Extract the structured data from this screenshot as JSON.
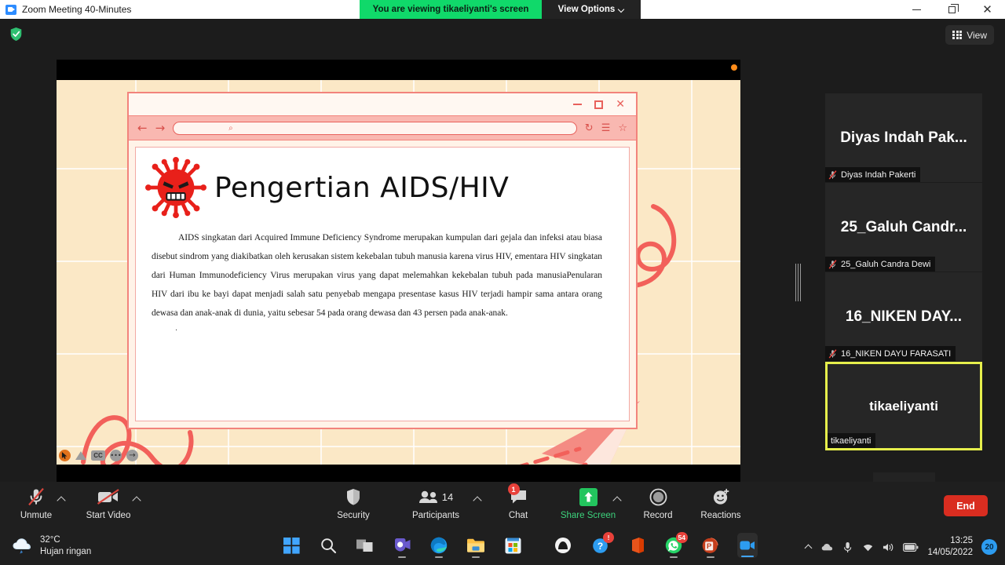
{
  "titlebar": {
    "app_title": "Zoom Meeting 40-Minutes",
    "share_banner": "You are viewing tikaeliyanti's screen",
    "view_options": "View Options",
    "minimize": "–",
    "restore": "❐",
    "close": "✕"
  },
  "stage": {
    "view_button": "View"
  },
  "slide": {
    "title": "Pengertian AIDS/HIV",
    "body": "AIDS singkatan dari Acquired Immune Deficiency Syndrome  merupakan kumpulan dari gejala dan infeksi atau biasa disebut sindrom  yang diakibatkan oleh kerusakan sistem kekebalan tubuh manusia karena  virus HIV, ementara HIV singkatan dari Human Immunodeficiency Virus merupakan virus yang dapat melemahkan kekebalan tubuh pada manusiaPenularan HIV dari ibu ke bayi dapat menjadi salah satu penyebab mengapa presentase kasus HIV terjadi hampir sama antara orang dewasa dan anak-anak di dunia, yaitu sebesar 54 pada orang dewasa dan 43 persen pada anak-anak.",
    "trailing_dot": ".",
    "browser": {
      "back": "←",
      "forward": "→",
      "search_glyph": "⌕",
      "reload": "↻",
      "menu": "☰",
      "bookmark": "☆",
      "minimize": "–",
      "maximize": "□",
      "close": "✕"
    },
    "annotation_bar": {
      "cc_label": "CC",
      "more": "•••",
      "arrow": "→"
    }
  },
  "participants": [
    {
      "initials": "Diyas Indah Pak...",
      "name": "Diyas Indah Pakerti",
      "muted": true,
      "active": false
    },
    {
      "initials": "25_Galuh Candr...",
      "name": "25_Galuh Candra Dewi",
      "muted": true,
      "active": false
    },
    {
      "initials": "16_NIKEN DAY...",
      "name": "16_NIKEN DAYU FARASATI",
      "muted": true,
      "active": false
    },
    {
      "initials": "tikaeliyanti",
      "name": "tikaeliyanti",
      "muted": false,
      "active": true
    }
  ],
  "toolbar": {
    "unmute": "Unmute",
    "start_video": "Start Video",
    "security": "Security",
    "participants": "Participants",
    "participants_count": "14",
    "chat": "Chat",
    "chat_badge": "1",
    "share_screen": "Share Screen",
    "record": "Record",
    "reactions": "Reactions",
    "end": "End"
  },
  "taskbar": {
    "weather_temp": "32°C",
    "weather_desc": "Hujan ringan",
    "time": "13:25",
    "date": "14/05/2022",
    "notification_count": "20",
    "badges": {
      "help": "!",
      "whatsapp": "54"
    }
  },
  "colors": {
    "share_green": "#10d96a",
    "accent_red": "#d92d20",
    "share_screen_green": "#23c55e",
    "active_speaker_border": "#e6ef4c",
    "slide_bg": "#fbe8c6",
    "slide_accent": "#f2837c",
    "badge_red": "#e8413a"
  }
}
